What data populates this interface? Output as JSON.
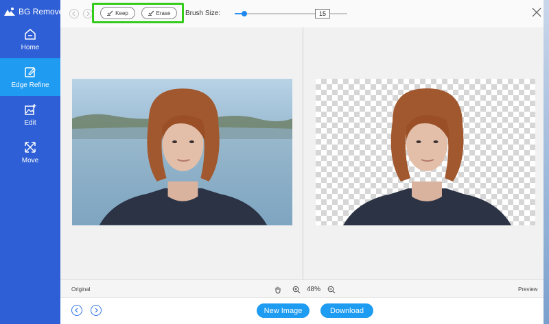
{
  "app": {
    "title": "BG Remover"
  },
  "sidebar": {
    "items": [
      {
        "label": "Home",
        "icon": "home-icon",
        "active": false
      },
      {
        "label": "Edge Refine",
        "icon": "edit-brush-icon",
        "active": true
      },
      {
        "label": "Edit",
        "icon": "image-edit-icon",
        "active": false
      },
      {
        "label": "Move",
        "icon": "move-arrows-icon",
        "active": false
      }
    ]
  },
  "toolbar": {
    "keep_label": "Keep",
    "erase_label": "Erase",
    "brush_size_label": "Brush Size:",
    "brush_size_value": "15",
    "brush_slider_fraction": 0.085,
    "highlight_color": "#33cc1a"
  },
  "status": {
    "original_label": "Original",
    "preview_label": "Preview",
    "zoom": "48%"
  },
  "footer": {
    "new_image_label": "New Image",
    "download_label": "Download"
  },
  "colors": {
    "sidebar": "#2e5fd6",
    "sidebar_active": "#1f9bf2",
    "accent": "#1e9cf2"
  }
}
